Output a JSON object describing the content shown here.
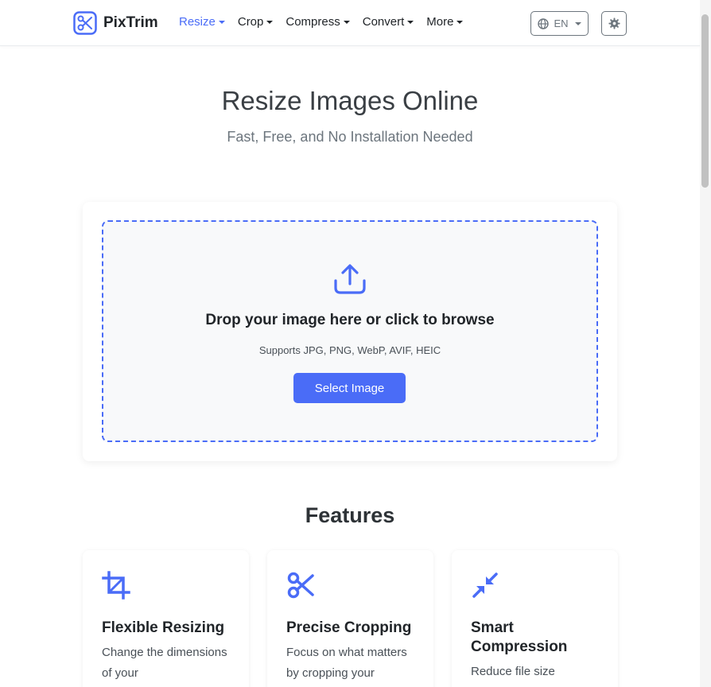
{
  "brand": {
    "name": "PixTrim",
    "accent_color": "#4a6cf7",
    "icon": "scissors-logo-icon"
  },
  "nav": {
    "items": [
      {
        "label": "Resize",
        "active": true
      },
      {
        "label": "Crop",
        "active": false
      },
      {
        "label": "Compress",
        "active": false
      },
      {
        "label": "Convert",
        "active": false
      },
      {
        "label": "More",
        "active": false
      }
    ]
  },
  "language": {
    "label": "EN",
    "icon": "globe-icon"
  },
  "settings": {
    "icon": "gear-icon"
  },
  "hero": {
    "title": "Resize Images Online",
    "subtitle": "Fast, Free, and No Installation Needed"
  },
  "upload": {
    "icon": "upload-icon",
    "title": "Drop your image here or click to browse",
    "formats": "Supports JPG, PNG, WebP, AVIF, HEIC",
    "button_label": "Select Image"
  },
  "features": {
    "title": "Features",
    "items": [
      {
        "icon": "crop-icon",
        "title": "Flexible Resizing",
        "description": "Change the dimensions of your"
      },
      {
        "icon": "scissors-icon",
        "title": "Precise Cropping",
        "description": "Focus on what matters by cropping your"
      },
      {
        "icon": "compress-arrows-icon",
        "title": "Smart Compression",
        "description": "Reduce file size"
      }
    ]
  }
}
